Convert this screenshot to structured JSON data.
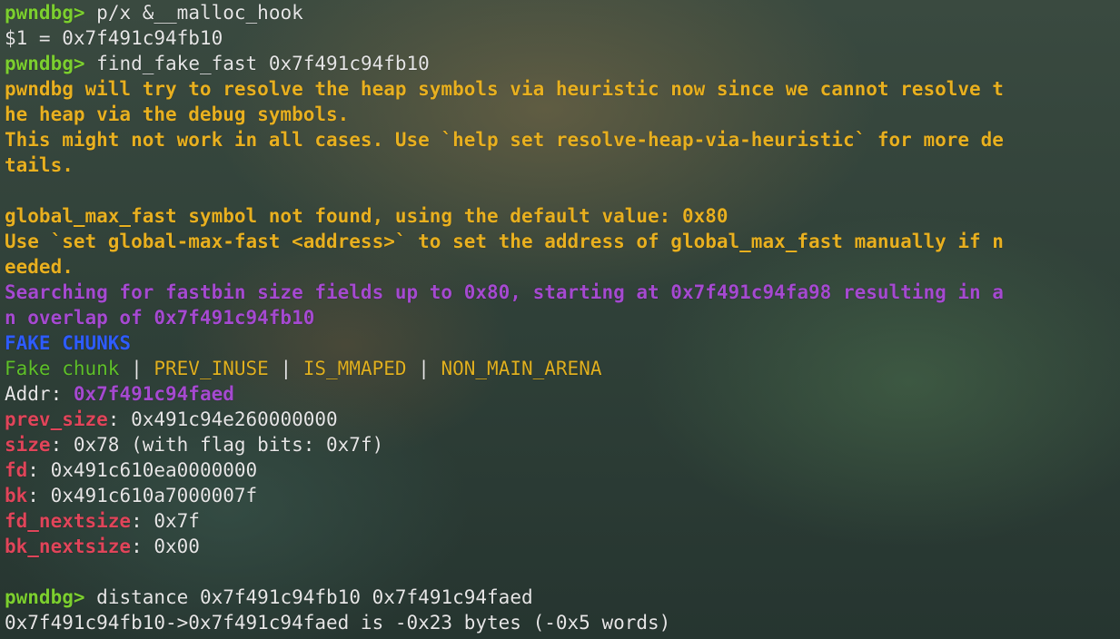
{
  "prompt": "pwndbg>",
  "cmd1": "p/x &__malloc_hook",
  "out1": "$1 = 0x7f491c94fb10",
  "cmd2": "find_fake_fast 0x7f491c94fb10",
  "warn1a": "pwndbg will try to resolve the heap symbols via heuristic now since we cannot resolve t",
  "warn1b": "he heap via the debug symbols.",
  "warn2a": "This might not work in all cases. Use `help set resolve-heap-via-heuristic` for more de",
  "warn2b": "tails.",
  "warn3": "global_max_fast symbol not found, using the default value: 0x80",
  "warn4a": "Use `set global-max-fast <address>` to set the address of global_max_fast manually if n",
  "warn4b": "eeded.",
  "search_a": "Searching for fastbin size fields up to 0x80, starting at 0x7f491c94fa98 resulting in a",
  "search_b": "n overlap of 0x7f491c94fb10",
  "fake_header": "FAKE CHUNKS",
  "chunk_label": "Fake chunk",
  "sep": " | ",
  "flag1": "PREV_INUSE",
  "flag2": "IS_MMAPED",
  "flag3": "NON_MAIN_ARENA",
  "addr_key": "Addr:",
  "addr_val": "0x7f491c94faed",
  "fields": {
    "prev_size_key": "prev_size",
    "prev_size_val": ": 0x491c94e260000000",
    "size_key": "size",
    "size_val": ": 0x78 (with flag bits: 0x7f)",
    "fd_key": "fd",
    "fd_val": ": 0x491c610ea0000000",
    "bk_key": "bk",
    "bk_val": ": 0x491c610a7000007f",
    "fd_nextsize_key": "fd_nextsize",
    "fd_nextsize_val": ": 0x7f",
    "bk_nextsize_key": "bk_nextsize",
    "bk_nextsize_val": ": 0x00"
  },
  "cmd3": "distance 0x7f491c94fb10 0x7f491c94faed",
  "out3": "0x7f491c94fb10->0x7f491c94faed is -0x23 bytes (-0x5 words)",
  "colors": {
    "prompt": "#7ccf2f",
    "warning": "#e8b020",
    "info": "#a54ad0",
    "header": "#2e5cff",
    "field": "#e0455a"
  }
}
